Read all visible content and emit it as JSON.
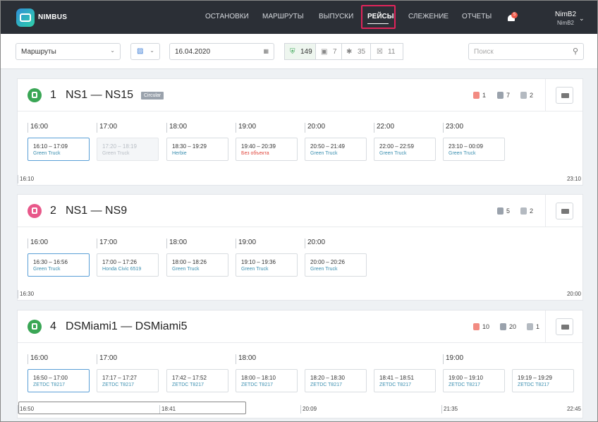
{
  "app": {
    "brand": "NIMBUS"
  },
  "nav": {
    "items": [
      "ОСТАНОВКИ",
      "МАРШРУТЫ",
      "ВЫПУСКИ",
      "РЕЙСЫ",
      "СЛЕЖЕНИЕ",
      "ОТЧЕТЫ"
    ],
    "active": "РЕЙСЫ",
    "notifications": "5"
  },
  "user": {
    "name": "NimB2",
    "sub": "NimB2"
  },
  "filters": {
    "routes_select": "Маршруты",
    "date": "16.04.2020",
    "search_placeholder": "Поиск",
    "counts": {
      "ok": "149",
      "vehicles": "7",
      "other": "35",
      "cancelled": "11"
    }
  },
  "routes": [
    {
      "num": "1",
      "name": "NS1 — NS15",
      "tag": "Circular",
      "icon_color": "#3aa655",
      "stats": {
        "errors": "1",
        "ok": "7",
        "vehicles": "2"
      },
      "hours": [
        "16:00",
        "17:00",
        "18:00",
        "19:00",
        "20:00",
        "22:00",
        "23:00"
      ],
      "trips": [
        {
          "time": "16:10 – 17:09",
          "vehicle": "Green Truck"
        },
        {
          "time": "17:20 – 18:19",
          "vehicle": "Green Truck"
        },
        {
          "time": "18:30 – 19:29",
          "vehicle": "Herbie"
        },
        {
          "time": "19:40 – 20:39",
          "vehicle": "Без объекта"
        },
        {
          "time": "20:50 – 21:49",
          "vehicle": "Green Truck"
        },
        {
          "time": "22:00 – 22:59",
          "vehicle": "Green Truck"
        },
        {
          "time": "23:10 – 00:09",
          "vehicle": "Green Truck"
        }
      ],
      "scale": {
        "start": "16:10",
        "end": "23:10"
      }
    },
    {
      "num": "2",
      "name": "NS1 — NS9",
      "icon_color": "#e8588a",
      "stats": {
        "ok": "5",
        "vehicles": "2"
      },
      "hours": [
        "16:00",
        "17:00",
        "18:00",
        "19:00",
        "20:00"
      ],
      "trips": [
        {
          "time": "16:30 – 16:56",
          "vehicle": "Green Truck"
        },
        {
          "time": "17:00 – 17:26",
          "vehicle": "Honda Civic 6519"
        },
        {
          "time": "18:00 – 18:26",
          "vehicle": "Green Truck"
        },
        {
          "time": "19:10 – 19:36",
          "vehicle": "Green Truck"
        },
        {
          "time": "20:00 – 20:26",
          "vehicle": "Green Truck"
        }
      ],
      "scale": {
        "start": "16:30",
        "end": "20:00"
      }
    },
    {
      "num": "4",
      "name": "DSMiami1 — DSMiami5",
      "icon_color": "#3aa655",
      "stats": {
        "errors": "10",
        "ok": "20",
        "vehicles": "1"
      },
      "hours": [
        "16:00",
        "17:00",
        "18:00",
        "19:00"
      ],
      "trips": [
        {
          "time": "16:50 – 17:00",
          "vehicle": "ZETDC T8217"
        },
        {
          "time": "17:17 – 17:27",
          "vehicle": "ZETDC T8217"
        },
        {
          "time": "17:42 – 17:52",
          "vehicle": "ZETDC T8217"
        },
        {
          "time": "18:00 – 18:10",
          "vehicle": "ZETDC T8217"
        },
        {
          "time": "18:20 – 18:30",
          "vehicle": "ZETDC T8217"
        },
        {
          "time": "18:41 – 18:51",
          "vehicle": "ZETDC T8217"
        },
        {
          "time": "19:00 – 19:10",
          "vehicle": "ZETDC T8217"
        },
        {
          "time": "19:19 – 19:29",
          "vehicle": "ZETDC T8217"
        }
      ],
      "scale": {
        "start": "16:50",
        "marks": [
          "18:41",
          "20:09",
          "21:35"
        ],
        "end": "22:45"
      }
    }
  ]
}
